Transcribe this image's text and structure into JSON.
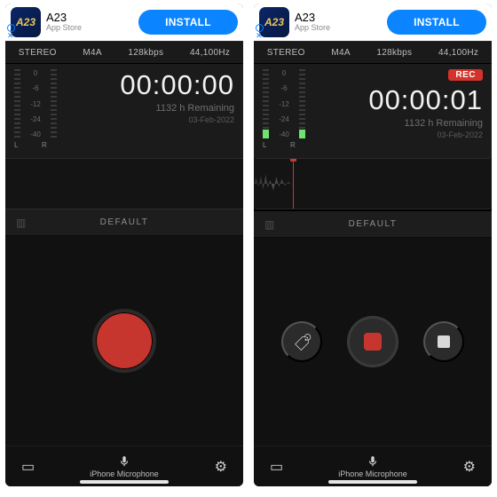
{
  "ad": {
    "app": "A23",
    "subtitle": "App Store",
    "cta": "INSTALL",
    "logo": "A23"
  },
  "topbar": {
    "channels": "STEREO",
    "format": "M4A",
    "bitrate": "128kbps",
    "sample": "44,100Hz"
  },
  "meter": {
    "ticks": [
      "0",
      "-6",
      "-12",
      "-24",
      "-40"
    ],
    "L": "L",
    "R": "R"
  },
  "left": {
    "time": "00:00:00",
    "remaining": "1132 h Remaining",
    "date": "03-Feb-2022",
    "folder": "DEFAULT",
    "micLabel": "iPhone Microphone"
  },
  "right": {
    "rec": "REC",
    "time": "00:00:01",
    "remaining": "1132 h Remaining",
    "date": "03-Feb-2022",
    "folder": "DEFAULT",
    "micLabel": "iPhone Microphone"
  }
}
